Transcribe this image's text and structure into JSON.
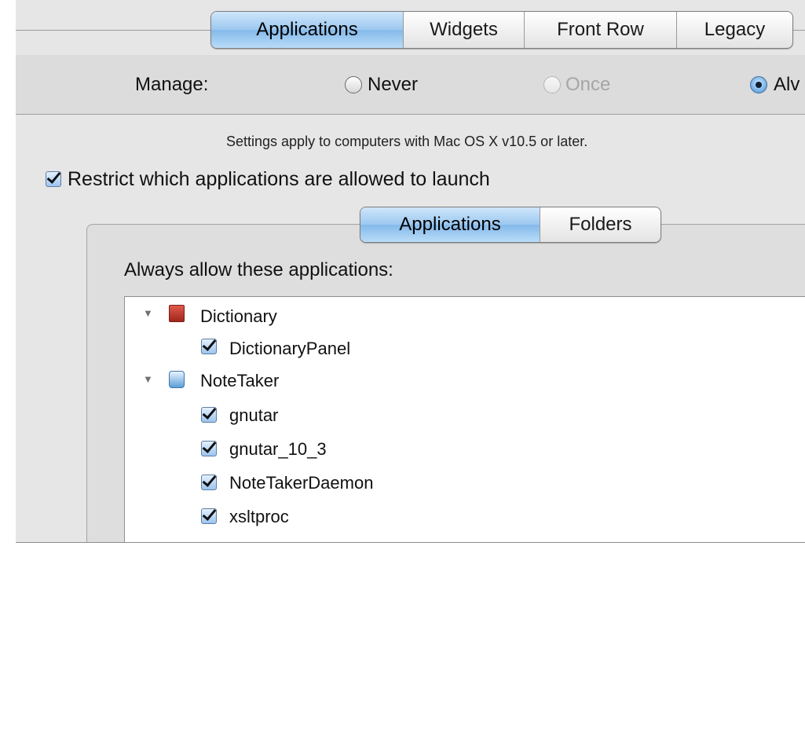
{
  "top_tabs": [
    "Applications",
    "Widgets",
    "Front Row",
    "Legacy"
  ],
  "manage": {
    "label": "Manage:",
    "options": [
      {
        "label": "Never",
        "state": "unselected"
      },
      {
        "label": "Once",
        "state": "disabled"
      },
      {
        "label": "Alv",
        "state": "selected"
      }
    ]
  },
  "notice": "Settings apply to computers with Mac OS X v10.5 or later.",
  "restrict_checkbox": {
    "label": "Restrict which applications are allowed to launch",
    "checked": true
  },
  "sub_tabs": [
    "Applications",
    "Folders"
  ],
  "allow_label": "Always allow these applications:",
  "apps": [
    {
      "name": "Dictionary",
      "icon": "dictionary-icon",
      "children": [
        {
          "name": "DictionaryPanel",
          "checked": true
        }
      ]
    },
    {
      "name": "NoteTaker",
      "icon": "notetaker-icon",
      "children": [
        {
          "name": "gnutar",
          "checked": true
        },
        {
          "name": "gnutar_10_3",
          "checked": true
        },
        {
          "name": "NoteTakerDaemon",
          "checked": true
        },
        {
          "name": "xsltproc",
          "checked": true
        }
      ]
    }
  ],
  "colors": {
    "selected_tab": "#9cc8f0",
    "panel": "#e6e6e6",
    "list_bg": "#ffffff"
  }
}
